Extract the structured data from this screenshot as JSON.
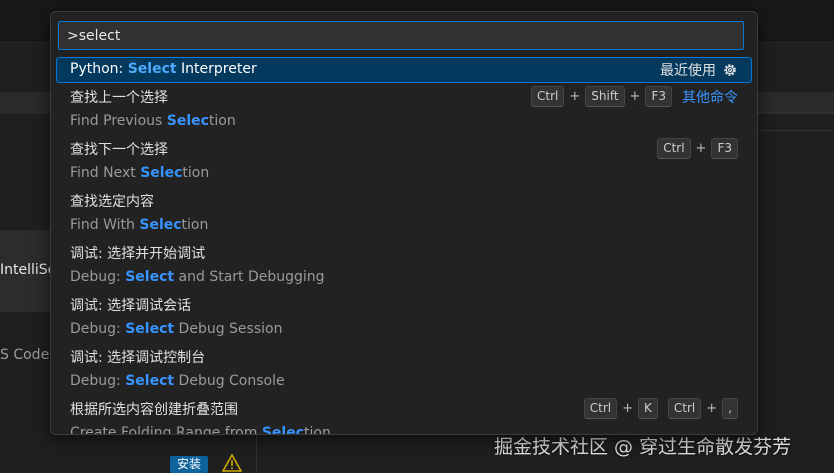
{
  "background": {
    "card_label": "IntelliSe",
    "vscode_label": "S Code",
    "install_label": "安装",
    "watermark": "掘金技术社区 @ 穿过生命散发芬芳"
  },
  "palette": {
    "query": ">select",
    "items": [
      {
        "title_pre": "Python: ",
        "title_hl": "Select",
        "title_post": " Interpreter",
        "right_label": "最近使用",
        "right_icon": "gear-icon"
      },
      {
        "title": "查找上一个选择",
        "sub_pre": "Find Previous ",
        "sub_hl": "Selec",
        "sub_post": "tion",
        "keys": [
          "Ctrl",
          "Shift",
          "F3"
        ],
        "right_link": "其他命令"
      },
      {
        "title": "查找下一个选择",
        "sub_pre": "Find Next ",
        "sub_hl": "Selec",
        "sub_post": "tion",
        "keys": [
          "Ctrl",
          "F3"
        ]
      },
      {
        "title": "查找选定内容",
        "sub_pre": "Find With ",
        "sub_hl": "Selec",
        "sub_post": "tion"
      },
      {
        "title": "调试: 选择并开始调试",
        "sub_pre": "Debug: ",
        "sub_hl": "Select",
        "sub_post": " and Start Debugging"
      },
      {
        "title": "调试: 选择调试会话",
        "sub_pre": "Debug: ",
        "sub_hl": "Select",
        "sub_post": " Debug Session"
      },
      {
        "title": "调试: 选择调试控制台",
        "sub_pre": "Debug: ",
        "sub_hl": "Select",
        "sub_post": " Debug Console"
      },
      {
        "title": "根据所选内容创建折叠范围",
        "sub_pre": "Create Folding Range from ",
        "sub_hl": "Selec",
        "sub_post": "tion",
        "keys": [
          "Ctrl",
          "K"
        ],
        "keys2": [
          "Ctrl",
          ","
        ]
      }
    ]
  },
  "colors": {
    "accent": "#0078d4",
    "highlight": "#3794ff",
    "selected_row": "#04395e"
  }
}
